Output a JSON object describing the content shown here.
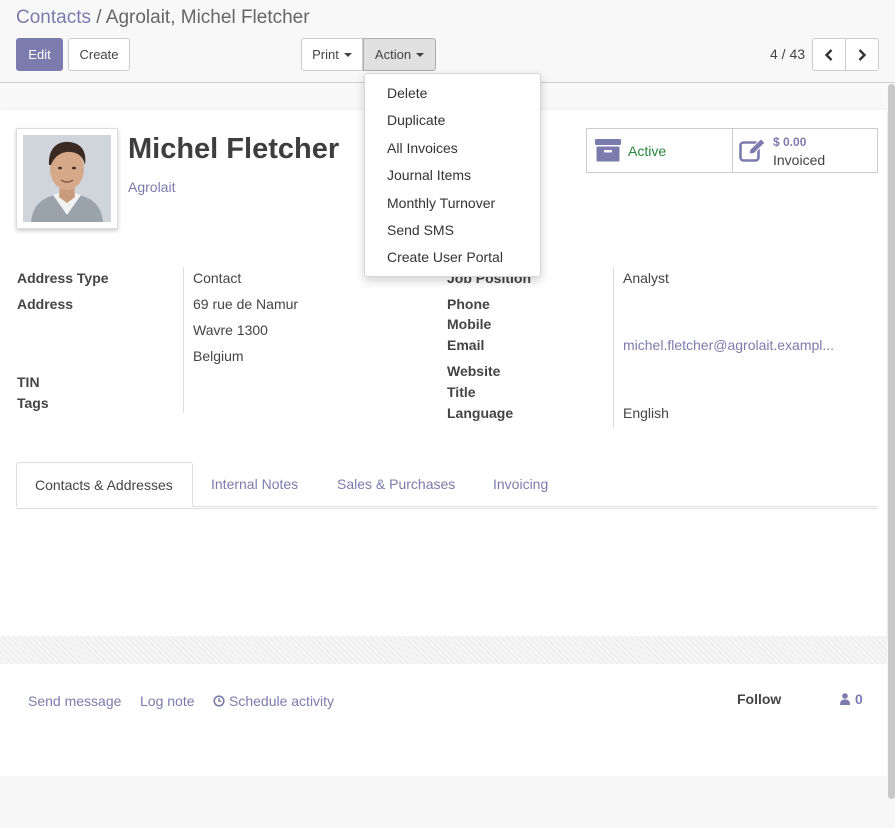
{
  "breadcrumb": {
    "parent": "Contacts",
    "separator": " / ",
    "current": "Agrolait, Michel Fletcher"
  },
  "toolbar": {
    "edit": "Edit",
    "create": "Create",
    "print": "Print",
    "action": "Action"
  },
  "pager": {
    "value": "4 / 43"
  },
  "action_menu": {
    "items": [
      "Delete",
      "Duplicate",
      "All Invoices",
      "Journal Items",
      "Monthly Turnover",
      "Send SMS",
      "Create User Portal"
    ]
  },
  "partner": {
    "name": "Michel Fletcher",
    "company": "Agrolait"
  },
  "smart_buttons": {
    "active_label": "Active",
    "invoiced_amount": "$ 0.00",
    "invoiced_label": "Invoiced"
  },
  "left_fields": {
    "address_type_label": "Address Type",
    "address_type_value": "Contact",
    "address_label": "Address",
    "street": "69 rue de Namur",
    "city_line": "Wavre 1300",
    "country": "Belgium",
    "tin_label": "TIN",
    "tags_label": "Tags"
  },
  "right_fields": {
    "job_position_label": "Job Position",
    "job_position_value": "Analyst",
    "phone_label": "Phone",
    "mobile_label": "Mobile",
    "email_label": "Email",
    "email_value": "michel.fletcher@agrolait.exampl...",
    "website_label": "Website",
    "title_label": "Title",
    "language_label": "Language",
    "language_value": "English"
  },
  "tabs": [
    "Contacts & Addresses",
    "Internal Notes",
    "Sales & Purchases",
    "Invoicing"
  ],
  "chatter": {
    "send_message": "Send message",
    "log_note": "Log note",
    "schedule_activity": "Schedule activity",
    "follow": "Follow",
    "followers_count": "0"
  },
  "colors": {
    "brand": "#7c7bad",
    "active_green": "#28863c"
  },
  "icons": [
    "chevron-left-icon",
    "chevron-right-icon",
    "archive-icon",
    "pencil-square-icon",
    "clock-icon",
    "user-icon"
  ]
}
